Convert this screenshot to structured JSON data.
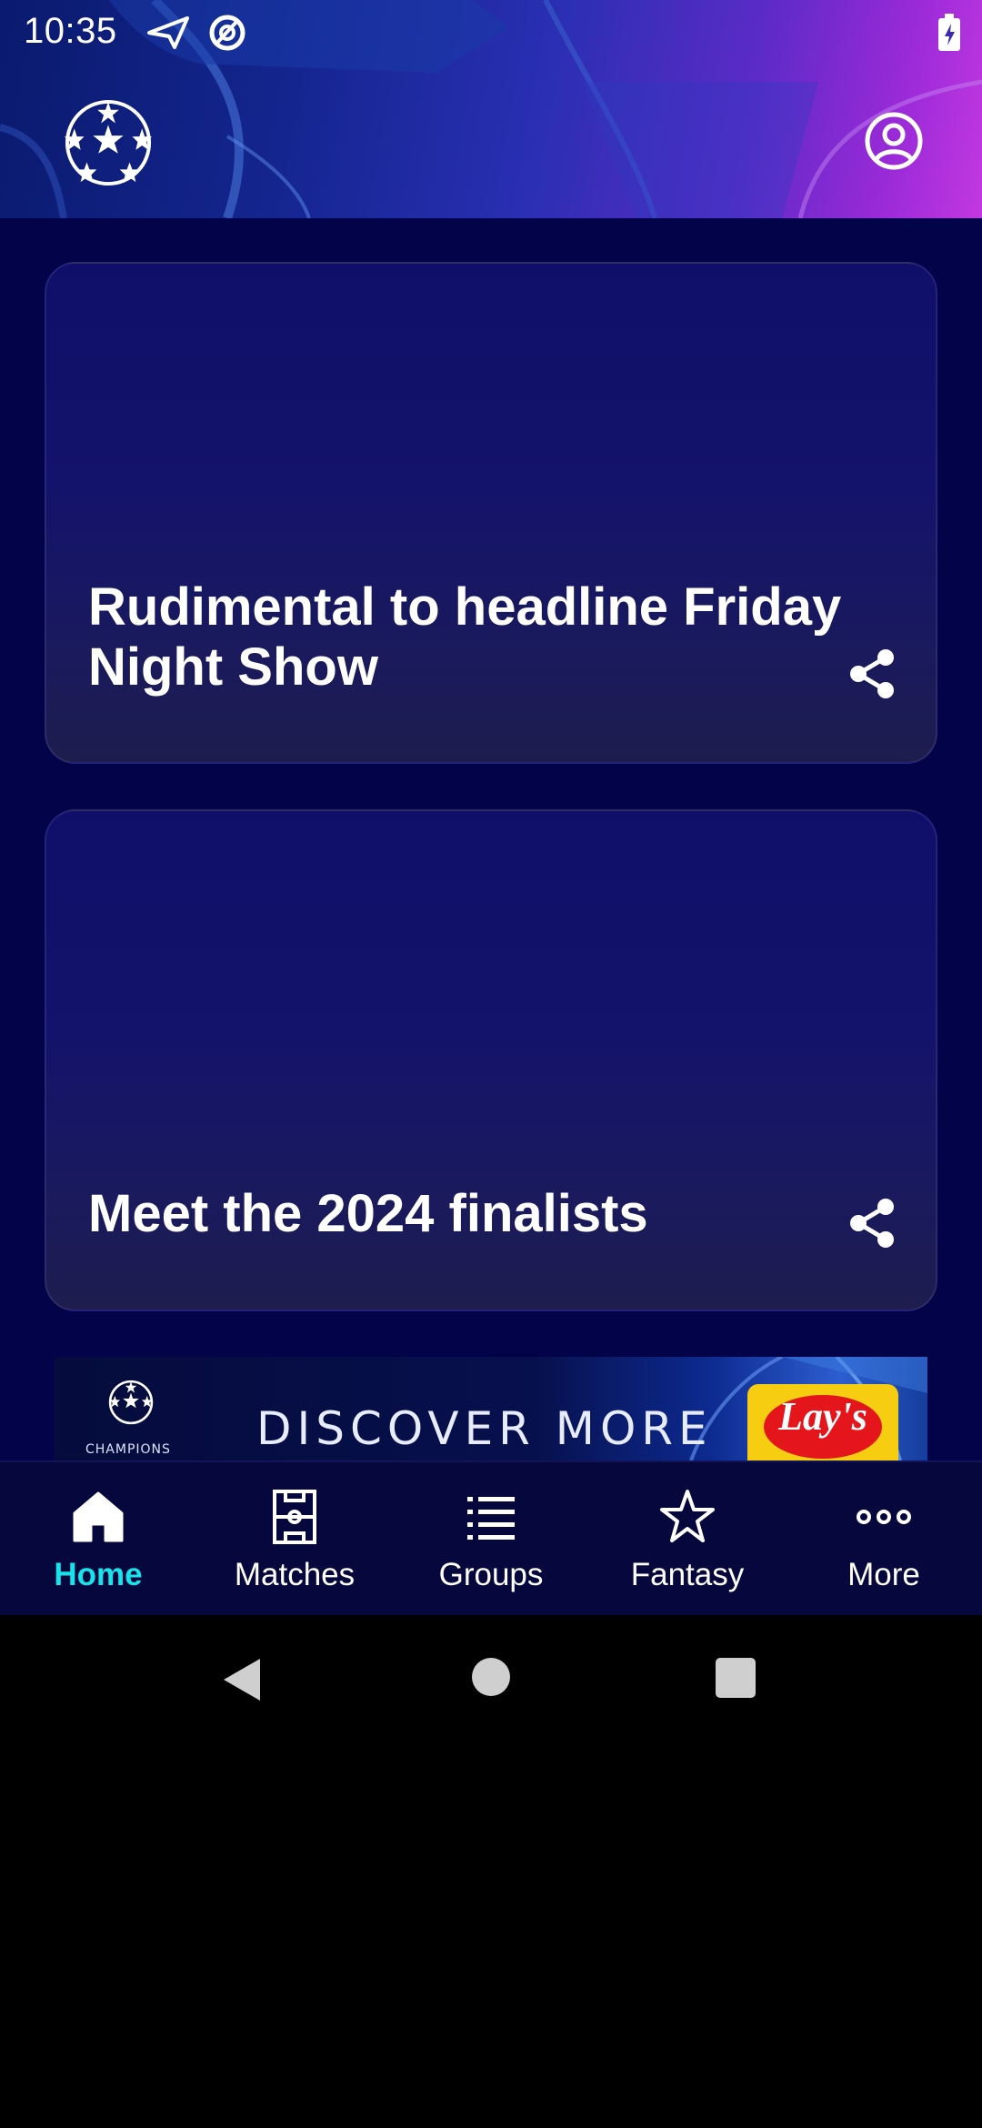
{
  "status_bar": {
    "time": "10:35",
    "icons": [
      "send-icon",
      "vpn-icon",
      "battery-charging-icon"
    ]
  },
  "header": {
    "logo_icon": "starball-logo-icon",
    "profile_icon": "account-circle-icon"
  },
  "cards": [
    {
      "title": "Rudimental to headline Friday Night Show",
      "share_icon": "share-icon"
    },
    {
      "title": "Meet the 2024 finalists",
      "share_icon": "share-icon"
    }
  ],
  "ad_banner": {
    "logo_text": "CHAMPIONS",
    "headline": "DISCOVER MORE",
    "brand_text": "Lay's"
  },
  "bottom_nav": {
    "items": [
      {
        "label": "Home",
        "icon": "home-icon",
        "active": true
      },
      {
        "label": "Matches",
        "icon": "pitch-icon",
        "active": false
      },
      {
        "label": "Groups",
        "icon": "list-icon",
        "active": false
      },
      {
        "label": "Fantasy",
        "icon": "star-icon",
        "active": false
      },
      {
        "label": "More",
        "icon": "more-horizontal-icon",
        "active": false
      }
    ]
  },
  "colors": {
    "background": "#03034a",
    "active_tab": "#19e3ea",
    "text": "#ffffff"
  },
  "system_nav": {
    "buttons": [
      "back-icon",
      "home-circle-icon",
      "recents-icon"
    ]
  }
}
